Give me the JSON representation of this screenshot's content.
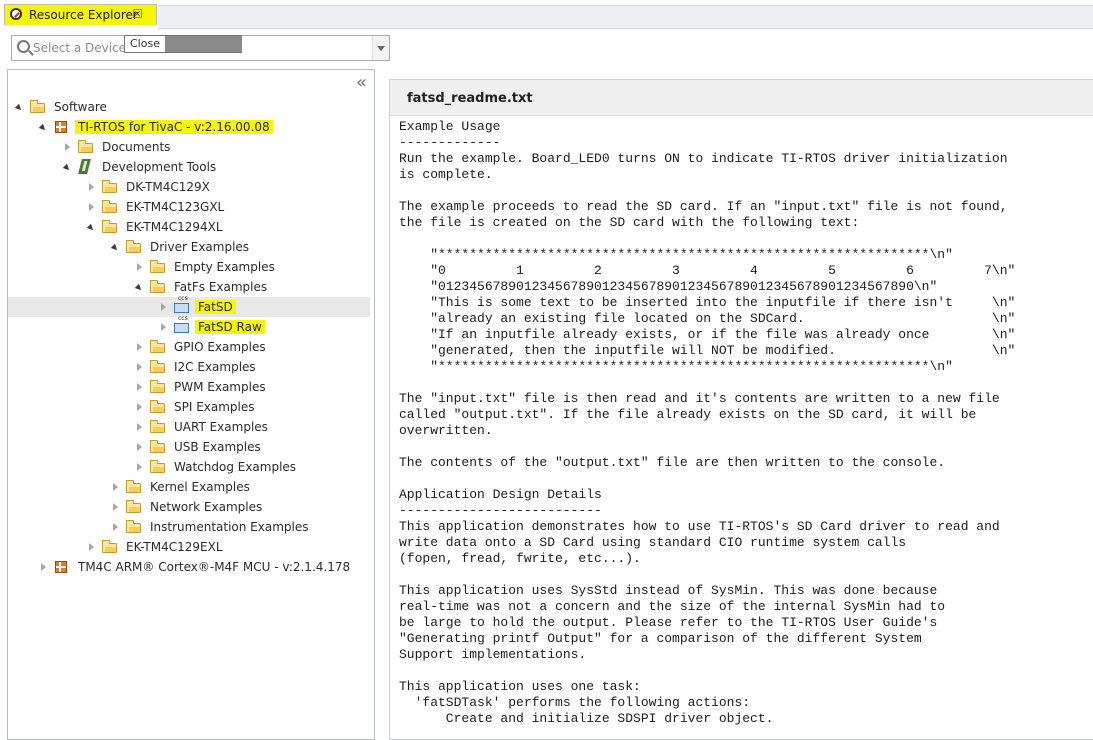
{
  "tab": {
    "title": "Resource Explorer",
    "icon": "compass-icon",
    "close_glyph": "☒"
  },
  "tooltip": {
    "text": "Close"
  },
  "device_selector": {
    "placeholder": "Select a Device o"
  },
  "tree": {
    "collapse_glyph": "«",
    "items": [
      {
        "label": "Software",
        "icon": "folder-icon",
        "state": "expanded",
        "highlighted": false,
        "selected": false
      },
      {
        "label": "TI-RTOS for TivaC - v:2.16.00.08",
        "icon": "package-icon",
        "state": "expanded",
        "highlighted": true,
        "selected": false
      },
      {
        "label": "Documents",
        "icon": "folder-icon",
        "state": "collapsed",
        "highlighted": false,
        "selected": false
      },
      {
        "label": "Development Tools",
        "icon": "tools-icon",
        "state": "expanded",
        "highlighted": false,
        "selected": false
      },
      {
        "label": "DK-TM4C129X",
        "icon": "folder-icon",
        "state": "collapsed",
        "highlighted": false,
        "selected": false
      },
      {
        "label": "EK-TM4C123GXL",
        "icon": "folder-icon",
        "state": "collapsed",
        "highlighted": false,
        "selected": false
      },
      {
        "label": "EK-TM4C1294XL",
        "icon": "folder-icon",
        "state": "expanded",
        "highlighted": false,
        "selected": false
      },
      {
        "label": "Driver Examples",
        "icon": "folder-icon",
        "state": "expanded",
        "highlighted": false,
        "selected": false
      },
      {
        "label": "Empty Examples",
        "icon": "folder-icon",
        "state": "collapsed",
        "highlighted": false,
        "selected": false
      },
      {
        "label": "FatFs Examples",
        "icon": "folder-icon",
        "state": "expanded",
        "highlighted": false,
        "selected": false
      },
      {
        "label": "FatSD",
        "icon": "ccs-project-icon",
        "state": "collapsed",
        "highlighted": true,
        "selected": true
      },
      {
        "label": "FatSD Raw",
        "icon": "ccs-project-icon",
        "state": "collapsed",
        "highlighted": true,
        "selected": false
      },
      {
        "label": "GPIO Examples",
        "icon": "folder-icon",
        "state": "collapsed",
        "highlighted": false,
        "selected": false
      },
      {
        "label": "I2C Examples",
        "icon": "folder-icon",
        "state": "collapsed",
        "highlighted": false,
        "selected": false
      },
      {
        "label": "PWM Examples",
        "icon": "folder-icon",
        "state": "collapsed",
        "highlighted": false,
        "selected": false
      },
      {
        "label": "SPI Examples",
        "icon": "folder-icon",
        "state": "collapsed",
        "highlighted": false,
        "selected": false
      },
      {
        "label": "UART Examples",
        "icon": "folder-icon",
        "state": "collapsed",
        "highlighted": false,
        "selected": false
      },
      {
        "label": "USB Examples",
        "icon": "folder-icon",
        "state": "collapsed",
        "highlighted": false,
        "selected": false
      },
      {
        "label": "Watchdog Examples",
        "icon": "folder-icon",
        "state": "collapsed",
        "highlighted": false,
        "selected": false
      },
      {
        "label": "Kernel Examples",
        "icon": "folder-icon",
        "state": "collapsed",
        "highlighted": false,
        "selected": false
      },
      {
        "label": "Network Examples",
        "icon": "folder-icon",
        "state": "collapsed",
        "highlighted": false,
        "selected": false
      },
      {
        "label": "Instrumentation Examples",
        "icon": "folder-icon",
        "state": "collapsed",
        "highlighted": false,
        "selected": false
      },
      {
        "label": "EK-TM4C129EXL",
        "icon": "folder-icon",
        "state": "collapsed",
        "highlighted": false,
        "selected": false
      },
      {
        "label": "TM4C ARM® Cortex®-M4F MCU - v:2.1.4.178",
        "icon": "package-icon",
        "state": "collapsed",
        "highlighted": false,
        "selected": false
      }
    ]
  },
  "document": {
    "title": "fatsd_readme.txt",
    "body": "Example Usage\n-------------\nRun the example. Board_LED0 turns ON to indicate TI-RTOS driver initialization\nis complete.\n\nThe example proceeds to read the SD card. If an \"input.txt\" file is not found,\nthe file is created on the SD card with the following text:\n\n    \"***************************************************************\\n\"\n    \"0         1         2         3         4         5         6         7\\n\"\n    \"0123456789012345678901234567890123456789012345678901234567890\\n\"\n    \"This is some text to be inserted into the inputfile if there isn't     \\n\"\n    \"already an existing file located on the SDCard.                        \\n\"\n    \"If an inputfile already exists, or if the file was already once        \\n\"\n    \"generated, then the inputfile will NOT be modified.                    \\n\"\n    \"***************************************************************\\n\"\n\nThe \"input.txt\" file is then read and it's contents are written to a new file\ncalled \"output.txt\". If the file already exists on the SD card, it will be\noverwritten.\n\nThe contents of the \"output.txt\" file are then written to the console.\n\nApplication Design Details\n--------------------------\nThis application demonstrates how to use TI-RTOS's SD Card driver to read and\nwrite data onto a SD Card using standard CIO runtime system calls\n(fopen, fread, fwrite, etc...).\n\nThis application uses SysStd instead of SysMin. This was done because\nreal-time was not a concern and the size of the internal SysMin had to\nbe large to hold the output. Please refer to the TI-RTOS User Guide's\n\"Generating printf Output\" for a comparison of the different System\nSupport implementations.\n\nThis application uses one task:\n  'fatSDTask' performs the following actions:\n      Create and initialize SDSPI driver object."
  },
  "colors": {
    "highlight": "#f6f600",
    "selection": "#e8e8e8",
    "header_bg": "#f0f0f0"
  }
}
